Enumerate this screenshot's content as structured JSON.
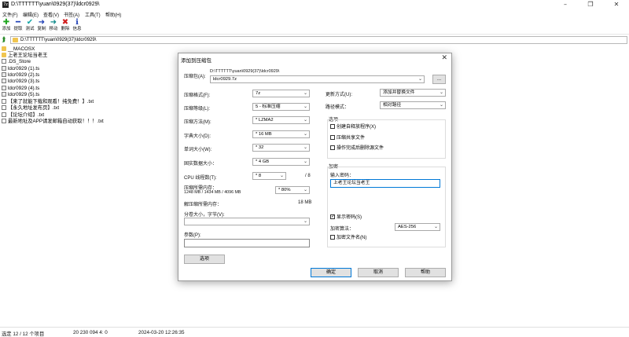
{
  "window": {
    "title": "D:\\TTTTTT\\yuan\\0929(37)\\ldcr0929\\",
    "app_icon": "7z"
  },
  "menu": [
    "文件(F)",
    "编辑(E)",
    "查看(V)",
    "书签(A)",
    "工具(T)",
    "帮助(H)"
  ],
  "toolbar": [
    {
      "label": "添加",
      "icon": "add-icon"
    },
    {
      "label": "提取",
      "icon": "extract-icon"
    },
    {
      "label": "测试",
      "icon": "test-icon"
    },
    {
      "label": "复制",
      "icon": "copy-icon"
    },
    {
      "label": "移动",
      "icon": "move-icon"
    },
    {
      "label": "删除",
      "icon": "delete-icon"
    },
    {
      "label": "信息",
      "icon": "info-icon"
    }
  ],
  "address": "D:\\TTTTTT\\yuan\\0929(37)\\ldcr0929\\",
  "files": [
    {
      "name": "__MACOSX",
      "type": "folder"
    },
    {
      "name": "上老王论坛当老王",
      "type": "folder"
    },
    {
      "name": ".DS_Store",
      "type": "file"
    },
    {
      "name": "ldcr0929 (1).ts",
      "type": "ts"
    },
    {
      "name": "ldcr0929 (2).ts",
      "type": "ts"
    },
    {
      "name": "ldcr0929 (3).ts",
      "type": "ts"
    },
    {
      "name": "ldcr0929 (4).ts",
      "type": "ts"
    },
    {
      "name": "ldcr0929 (5).ts",
      "type": "ts"
    },
    {
      "name": "【来了就能下载和观看！纯免费！】.txt",
      "type": "file"
    },
    {
      "name": "【永久地址发布页】.txt",
      "type": "file"
    },
    {
      "name": "【论坛介绍】.txt",
      "type": "file"
    },
    {
      "name": "最新地址及APP请发邮箱自动获取！！！.txt",
      "type": "file"
    }
  ],
  "status": {
    "selection": "选定 12 / 12 个项目",
    "size": "20 230 094 4: 0",
    "date": "2024-03-20 12:26:35"
  },
  "dialog": {
    "title": "添加到压缩包",
    "archive_label": "压缩包(A):",
    "archive_path": "D:\\TTTTTT\\yuan\\0929(37)\\ldcr0929\\",
    "archive_name": "ldcr0929.7z",
    "browse": "...",
    "format_label": "压缩格式(F):",
    "format_value": "7z",
    "level_label": "压缩等级(L):",
    "level_value": "5 - 标准压缩",
    "method_label": "压缩方法(M):",
    "method_value": "* LZMA2",
    "dict_label": "字典大小(D):",
    "dict_value": "* 16 MB",
    "word_label": "单词大小(W):",
    "word_value": "* 32",
    "solid_label": "固实数据大小：",
    "solid_value": "* 4 GB",
    "cpu_label": "CPU 线程数(T):",
    "cpu_value": "* 8",
    "cpu_total": "/ 8",
    "mem_label": "压缩所需内存：",
    "mem_detail": "1248 MB / 1434 MB / 4096 MB",
    "mem_value": "* 80%",
    "decomp_label": "解压缩所需内存：",
    "decomp_value": "18 MB",
    "split_label": "分卷大小，字节(V):",
    "params_label": "参数(P):",
    "options_button": "选项",
    "update_label": "更新方式(U):",
    "update_value": "添加并替换文件",
    "path_label": "路径模式：",
    "path_value": "相对路径",
    "options_group": "选项",
    "opt_sfx": "创建自释放程序(X)",
    "opt_shared": "压缩共享文件",
    "opt_delete": "操作完成后删除源文件",
    "encrypt_group": "加密",
    "password_label": "输入密码：",
    "password_value": "上老王论坛当老王",
    "show_password": "显示密码(S)",
    "enc_method_label": "加密算法：",
    "enc_method_value": "AES-256",
    "enc_names": "加密文件名(N)",
    "ok": "确定",
    "cancel": "取消",
    "help": "帮助"
  }
}
